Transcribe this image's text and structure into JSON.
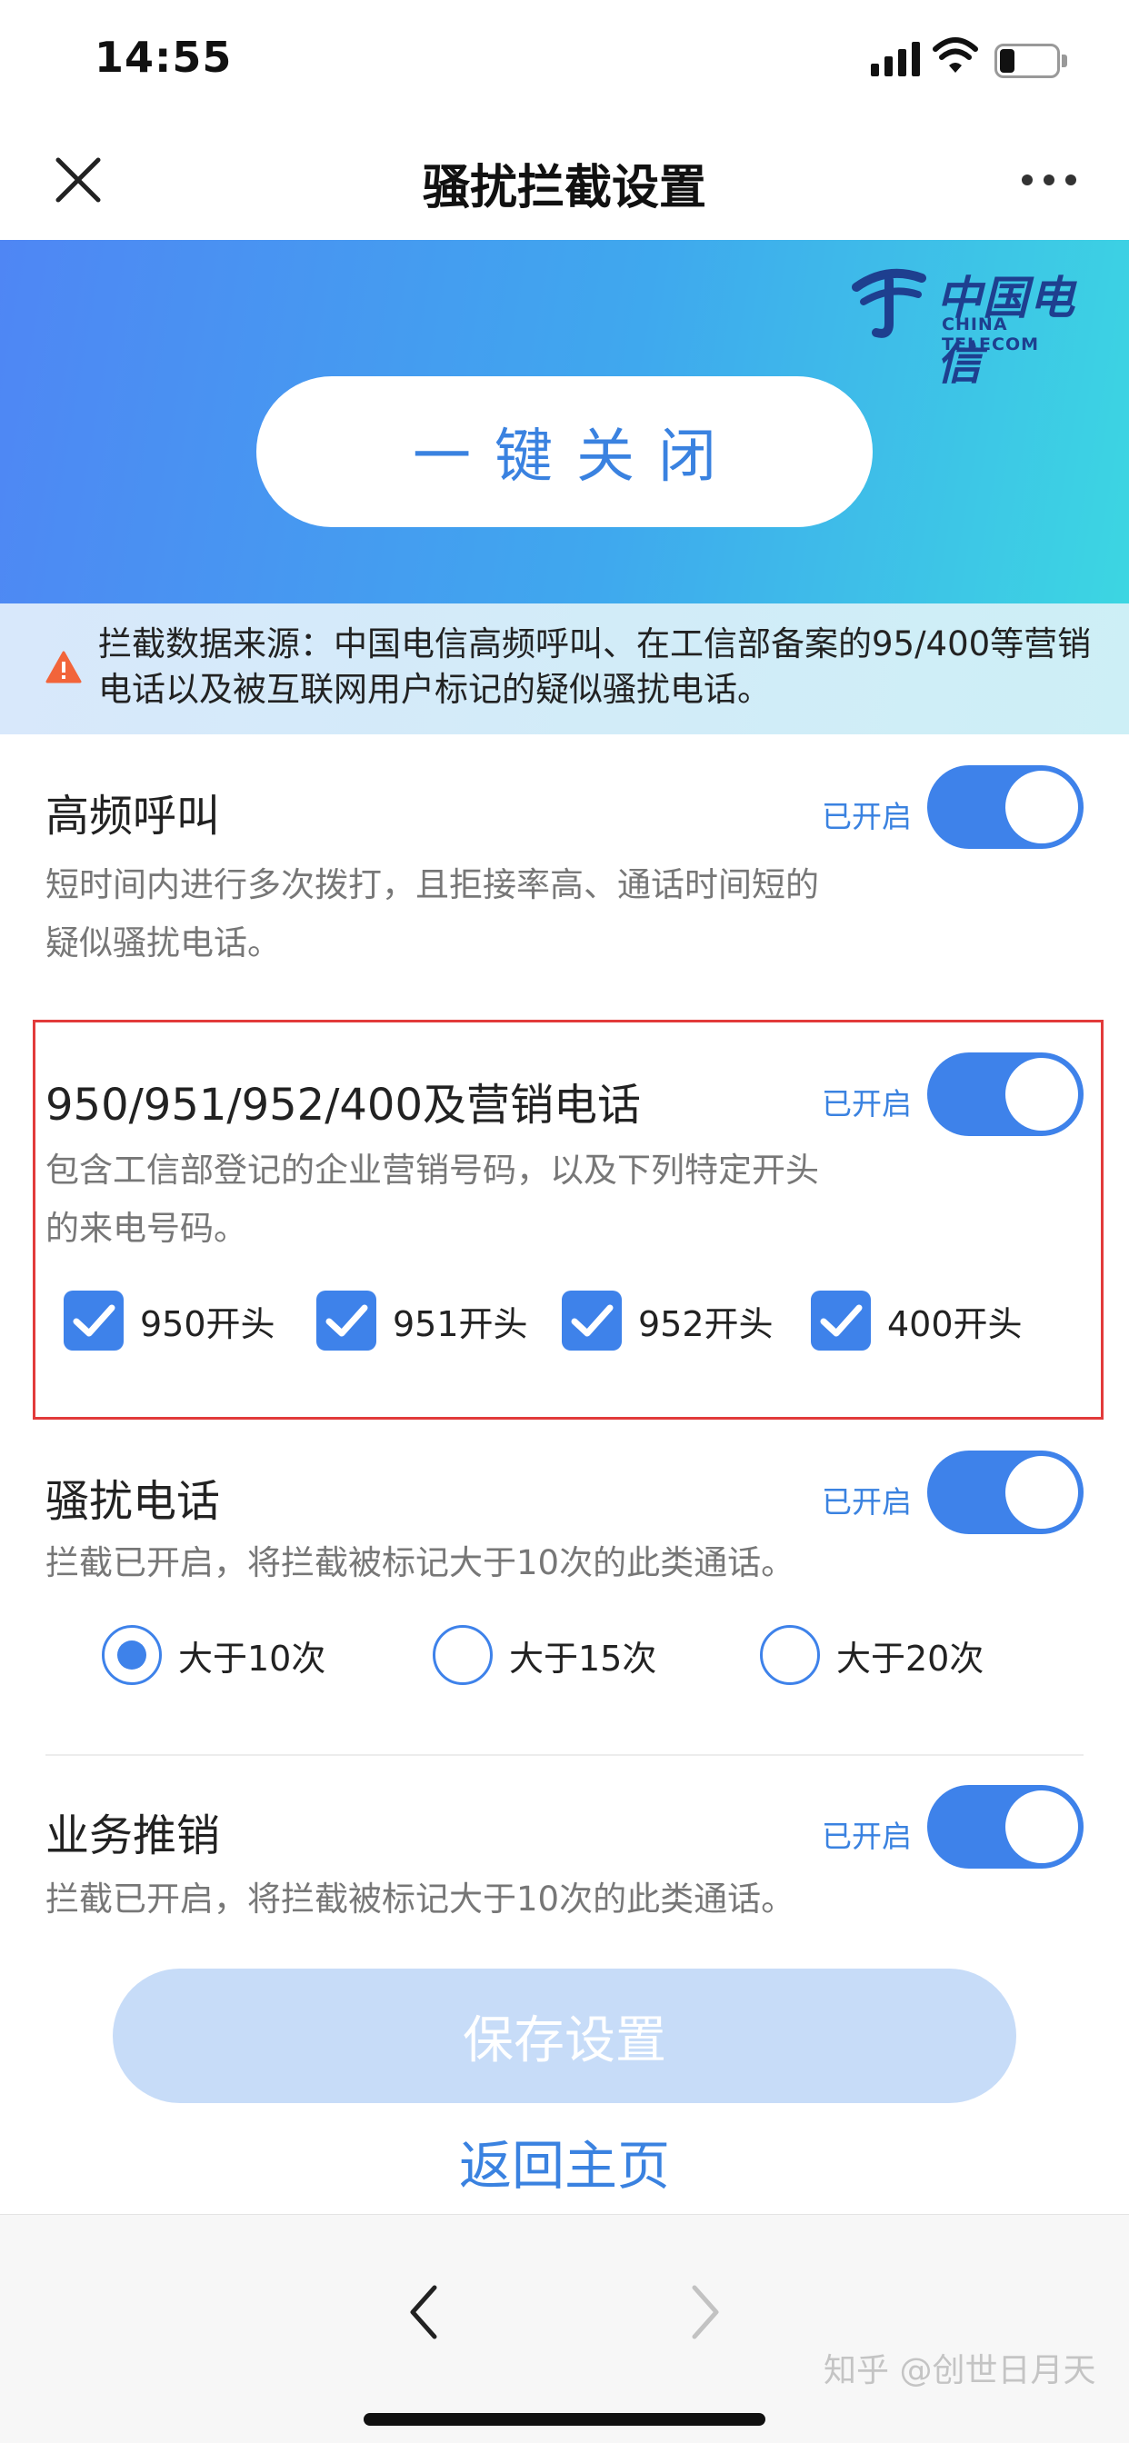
{
  "status_bar": {
    "time": "14:55"
  },
  "header": {
    "title": "骚扰拦截设置"
  },
  "banner": {
    "logo_cn": "中国电信",
    "logo_en": "CHINA TELECOM",
    "one_key_label": "一键关闭"
  },
  "notice": {
    "text": "拦截数据来源：中国电信高频呼叫、在工信部备案的95/400等营销电话以及被互联网用户标记的疑似骚扰电话。"
  },
  "sections": [
    {
      "title": "高频呼叫",
      "status": "已开启",
      "enabled": true,
      "description": "短时间内进行多次拨打，且拒接率高、通话时间短的疑似骚扰电话。"
    },
    {
      "title": "950/951/952/400及营销电话",
      "status": "已开启",
      "enabled": true,
      "description": "包含工信部登记的企业营销号码，以及下列特定开头的来电号码。",
      "options": [
        {
          "label": "950开头",
          "checked": true
        },
        {
          "label": "951开头",
          "checked": true
        },
        {
          "label": "952开头",
          "checked": true
        },
        {
          "label": "400开头",
          "checked": true
        }
      ]
    },
    {
      "title": "骚扰电话",
      "status": "已开启",
      "enabled": true,
      "description": "拦截已开启，将拦截被标记大于10次的此类通话。",
      "thresholds": [
        {
          "label": "大于10次",
          "selected": true
        },
        {
          "label": "大于15次",
          "selected": false
        },
        {
          "label": "大于20次",
          "selected": false
        }
      ]
    },
    {
      "title": "业务推销",
      "status": "已开启",
      "enabled": true,
      "description": "拦截已开启，将拦截被标记大于10次的此类通话。"
    }
  ],
  "actions": {
    "save_label": "保存设置",
    "home_label": "返回主页"
  },
  "footer": {
    "watermark": "知乎 @创世日月天"
  },
  "colors": {
    "accent": "#3e82ea",
    "banner_start": "#4f86f4",
    "banner_end": "#3cd6e2",
    "highlight_border": "#e23b3b",
    "save_disabled": "#c7dcf8"
  }
}
